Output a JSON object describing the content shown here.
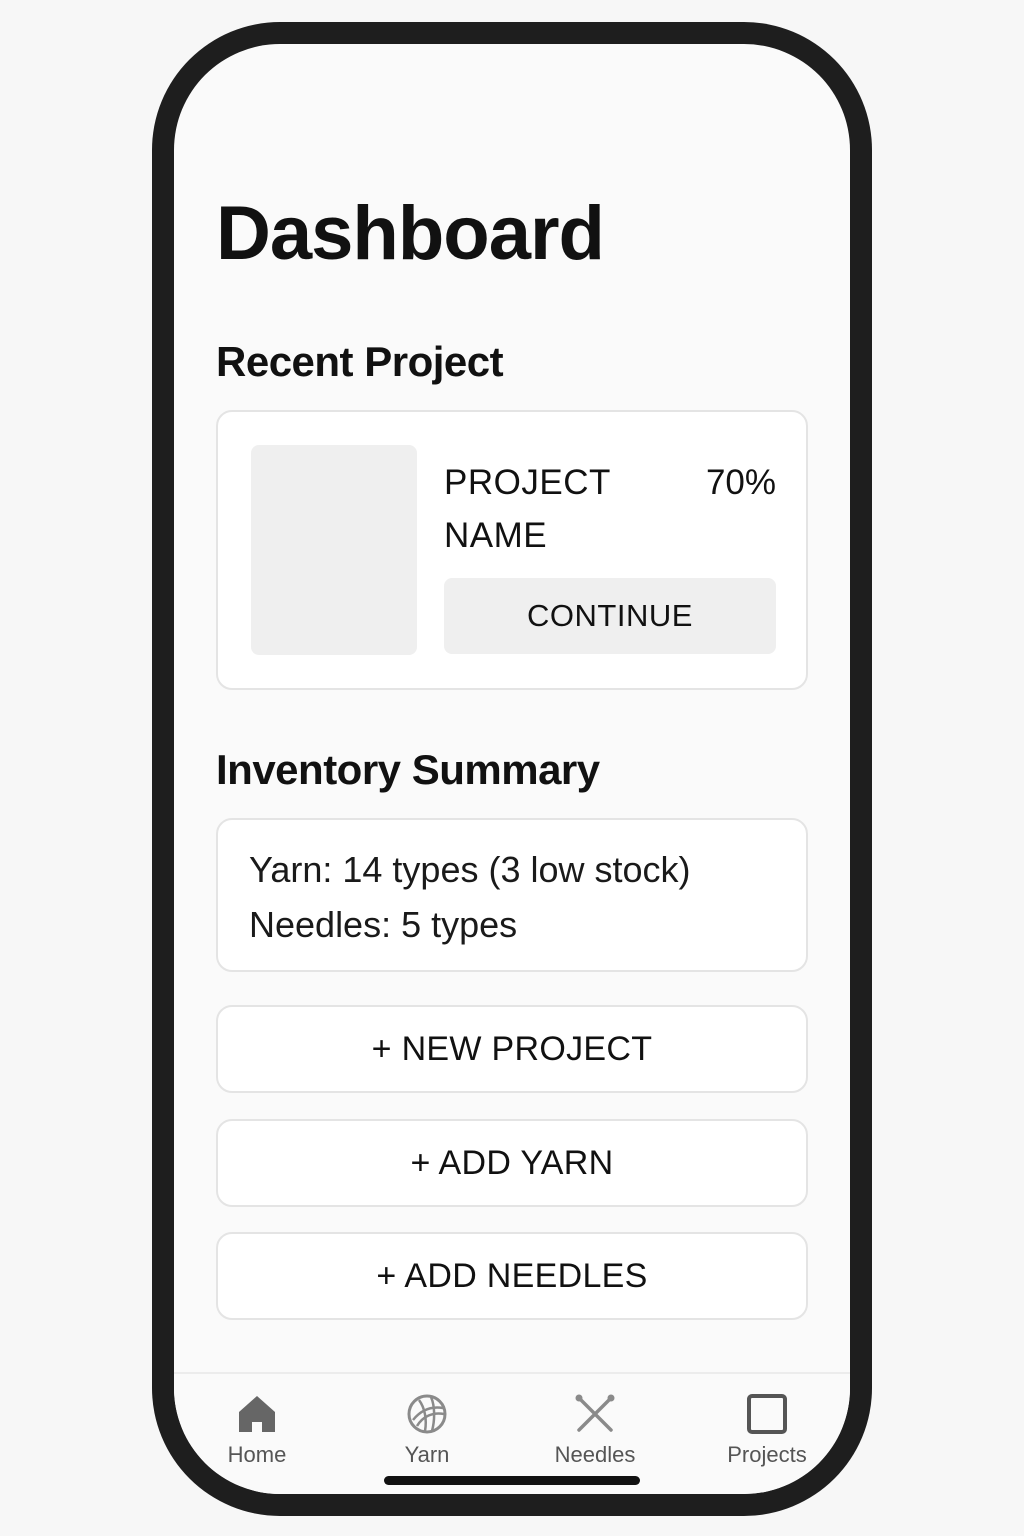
{
  "header": {
    "title": "Dashboard"
  },
  "recent_project": {
    "section_title": "Recent Project",
    "project_name": "PROJECT NAME",
    "progress_label": "70%",
    "progress": 0.7,
    "continue_label": "CONTINUE"
  },
  "inventory": {
    "section_title": "Inventory Summary",
    "yarn_line": "Yarn: 14 types (3 low stock)",
    "needles_line": "Needles: 5 types"
  },
  "actions": {
    "new_project": "+ NEW PROJECT",
    "add_yarn": "+ ADD YARN",
    "add_needles": "+ ADD NEEDLES"
  },
  "tabbar": {
    "items": [
      {
        "label": "Home",
        "icon": "home-icon",
        "active": true
      },
      {
        "label": "Yarn",
        "icon": "yarn-ball-icon",
        "active": false
      },
      {
        "label": "Needles",
        "icon": "crossed-needles-icon",
        "active": false
      },
      {
        "label": "Projects",
        "icon": "square-icon",
        "active": false
      }
    ]
  },
  "colors": {
    "background": "#f7f7f7",
    "phone_frame": "#1e1e1e",
    "screen": "#fafafa",
    "card": "#ffffff",
    "border": "#e4e4e4",
    "muted_fill": "#efefef",
    "icon_active": "#666666",
    "icon_inactive": "#8a8a8a"
  }
}
